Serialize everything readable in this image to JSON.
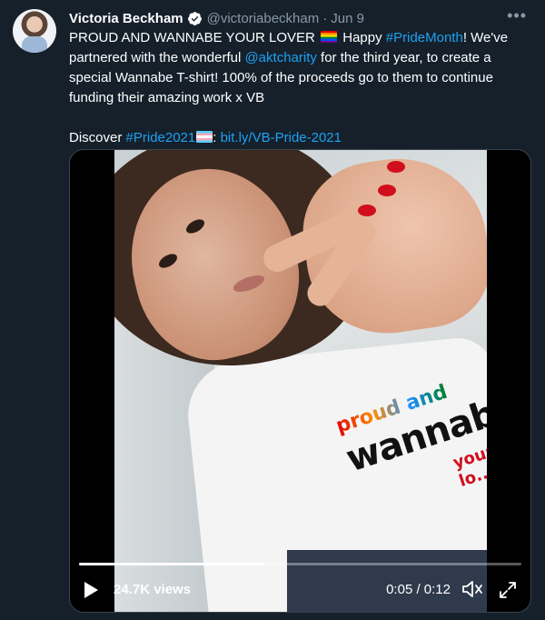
{
  "tweet": {
    "author_name": "Victoria Beckham",
    "handle": "@victoriabeckham",
    "separator": "·",
    "date": "Jun 9",
    "more_icon": "more-horizontal-icon",
    "text": {
      "p1_a": "PROUD AND WANNABE YOUR LOVER ",
      "p1_b": " Happy ",
      "hashtag_pride_month": "#PrideMonth",
      "p1_c": "! We've partnered with the wonderful ",
      "mention": "@aktcharity",
      "p1_d": " for the third year, to create a special Wannabe T-shirt! 100% of the proceeds go to them to continue funding their amazing work x VB",
      "p2_a": "Discover ",
      "hashtag_pride2021": "#Pride2021",
      "p2_b": ": ",
      "link": "bit.ly/VB-Pride-2021"
    }
  },
  "video": {
    "views": "24.7K views",
    "time": "0:05 / 0:12",
    "progress": 0.42,
    "shirt_print": {
      "line1": "proud and",
      "line2": "wannabe",
      "line3": "your lo..."
    }
  },
  "colors": {
    "background": "#15202b",
    "link": "#1da1f2",
    "muted": "#8899a6"
  }
}
